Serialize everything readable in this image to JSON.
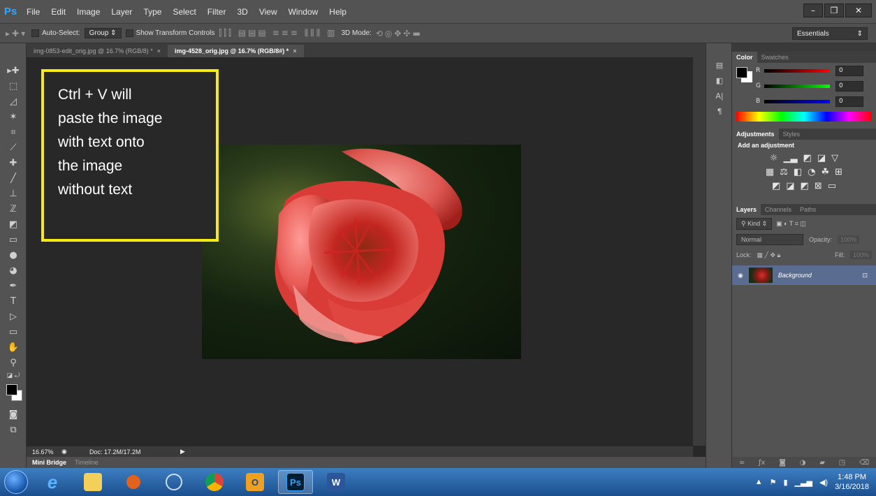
{
  "app": {
    "logo": "Ps"
  },
  "menu": [
    "File",
    "Edit",
    "Image",
    "Layer",
    "Type",
    "Select",
    "Filter",
    "3D",
    "View",
    "Window",
    "Help"
  ],
  "window_controls": {
    "minimize": "–",
    "restore": "❐",
    "close": "✕"
  },
  "options": {
    "auto_select_label": "Auto-Select:",
    "auto_select_value": "Group",
    "show_transform_label": "Show Transform Controls",
    "mode_3d_label": "3D Mode:",
    "workspace": "Essentials"
  },
  "tabs": [
    {
      "label": "img-0853-edit_orig.jpg @ 16.7% (RGB/8) *",
      "close": "×"
    },
    {
      "label": "img-4528_orig.jpg @ 16.7% (RGB/8#) *",
      "close": "×"
    }
  ],
  "callout": {
    "line1": "Ctrl + V will",
    "line2": "paste the image",
    "line3": "with text onto",
    "line4": "the image",
    "line5": "without text"
  },
  "status": {
    "zoom": "16.67%",
    "doc": "Doc: 17.2M/17.2M"
  },
  "bottom_tabs": [
    "Mini Bridge",
    "Timeline"
  ],
  "color_panel": {
    "tabs": [
      "Color",
      "Swatches"
    ],
    "channels": [
      {
        "label": "R",
        "value": "0"
      },
      {
        "label": "G",
        "value": "0"
      },
      {
        "label": "B",
        "value": "0"
      }
    ]
  },
  "adjust_panel": {
    "tabs": [
      "Adjustments",
      "Styles"
    ],
    "heading": "Add an adjustment"
  },
  "layers_panel": {
    "tabs": [
      "Layers",
      "Channels",
      "Paths"
    ],
    "filter": "Kind",
    "blend": "Normal",
    "opacity_label": "Opacity:",
    "opacity_value": "100%",
    "lock_label": "Lock:",
    "fill_label": "Fill:",
    "fill_value": "100%",
    "layer_name": "Background"
  },
  "taskbar": {
    "time": "1:48 PM",
    "date": "3/16/2018"
  },
  "colors": {
    "accent_yellow": "#f5ea14",
    "ps_blue": "#31a8ff",
    "layer_selected": "#5a6d91"
  }
}
